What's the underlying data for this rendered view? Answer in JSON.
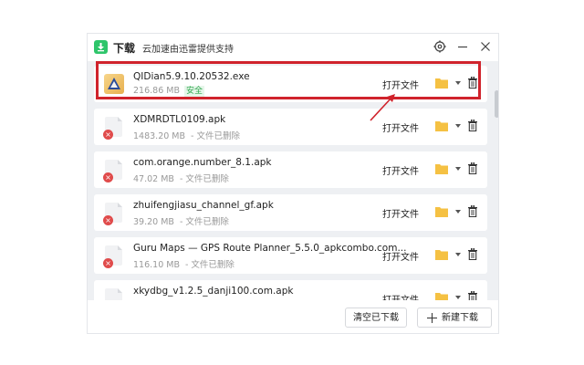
{
  "header": {
    "title": "下载",
    "subtitle": "云加速由迅雷提供支持",
    "settings_icon": "gear-icon",
    "minimize_icon": "minimize-icon",
    "close_icon": "close-icon"
  },
  "items": [
    {
      "name": "QIDian5.9.10.20532.exe",
      "size": "216.86 MB",
      "status": "安全",
      "open_label": "打开文件"
    },
    {
      "name": "XDMRDTL0109.apk",
      "size": "1483.20 MB",
      "status": "- 文件已删除",
      "open_label": "打开文件"
    },
    {
      "name": "com.orange.number_8.1.apk",
      "size": "47.02 MB",
      "status": "- 文件已删除",
      "open_label": "打开文件"
    },
    {
      "name": "zhuifengjiasu_channel_gf.apk",
      "size": "39.20 MB",
      "status": "- 文件已删除",
      "open_label": "打开文件"
    },
    {
      "name": "Guru Maps — GPS Route Planner_5.5.0_apkcombo.com...",
      "size": "116.10 MB",
      "status": "- 文件已删除",
      "open_label": "打开文件"
    },
    {
      "name": "xkydbg_v1.2.5_danji100.com.apk",
      "size": "",
      "status": "",
      "open_label": "打开文件"
    }
  ],
  "footer": {
    "clear_label": "清空已下载",
    "new_label": "新建下载"
  },
  "colors": {
    "accent": "#2ec56a",
    "highlight": "#d0232c",
    "folder": "#f5c143",
    "deleted_badge": "#e04b4b"
  }
}
